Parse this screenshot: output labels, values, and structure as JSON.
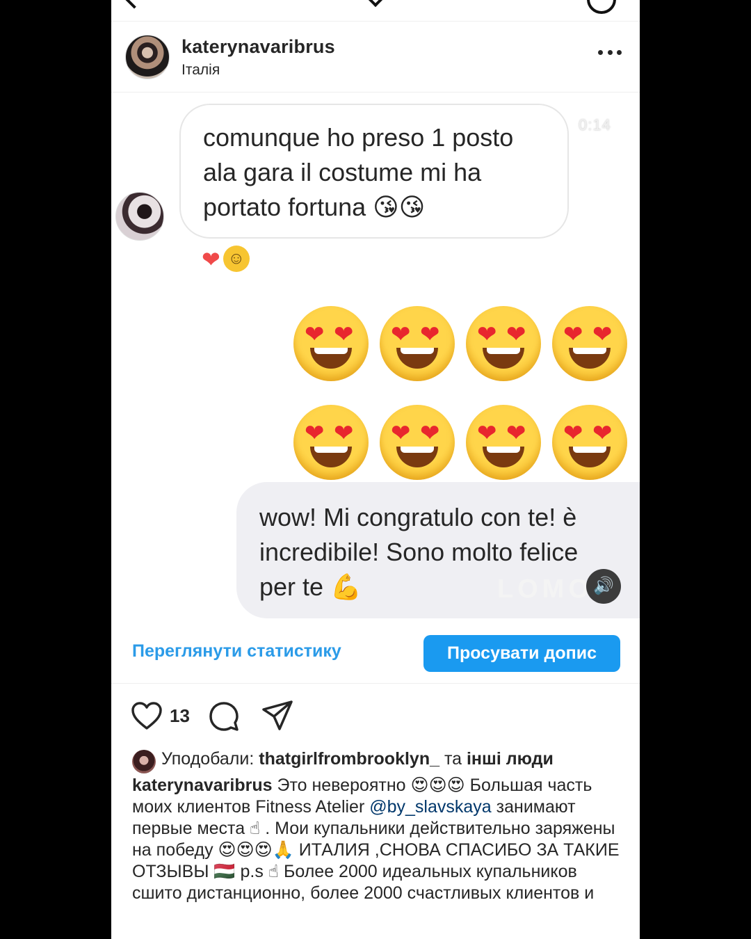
{
  "header": {
    "username": "katerynavaribrus",
    "location": "Італія"
  },
  "media": {
    "incoming_message": "comunque ho preso 1 posto ala gara il costume mi ha portato fortuna 😘😘",
    "timestamp": "0:14",
    "reaction_heart": "❤",
    "reaction_face": "🫡",
    "emoji_count": 8,
    "outgoing_message": "wow! Mi congratulo con te! è incredibile! Sono molto felice per te 💪",
    "watermark": "LOMOT"
  },
  "actions": {
    "stats_link": "Переглянути статистику",
    "promote_button": "Просувати допис"
  },
  "engagement": {
    "like_count": "13"
  },
  "caption": {
    "liked_prefix": "Уподобали:",
    "liked_user": "thatgirlfrombrooklyn_",
    "liked_conj": "та",
    "liked_others": "інші люди",
    "author": "katerynavaribrus",
    "text_part1": "Это невероятно 😍😍😍 Большая часть моих клиентов Fitness Atelier",
    "mention": "@by_slavskaya",
    "text_part2": "занимают первые места ☝ . Мои купальники действительно заряжены на победу 😍😍😍🙏 ИТАЛИЯ ,СНОВА СПАСИБО ЗА ТАКИЕ ОТЗЫВЫ 🇭🇺 p.s ☝ Более 2000 идеальных купальников сшито дистанционно, более 2000 счастливых клиентов и"
  }
}
